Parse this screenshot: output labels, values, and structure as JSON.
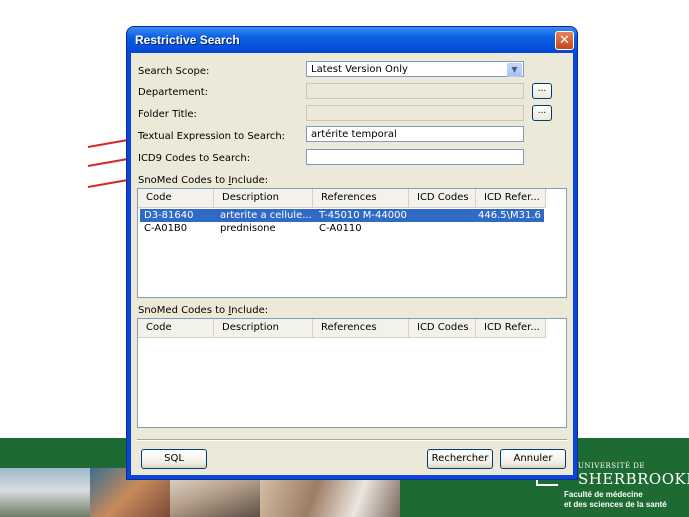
{
  "dialog": {
    "title": "Restrictive Search",
    "close_symbol": "✕"
  },
  "form": {
    "search_scope_label": "Search Scope:",
    "search_scope_value": "Latest Version Only",
    "departement_label": "Departement:",
    "folder_title_label": "Folder Title:",
    "browse_label": "...",
    "textual_label": "Textual Expression to Search:",
    "textual_value": "artérite temporal",
    "icd9_label": "ICD9 Codes to Search:",
    "icd9_value": ""
  },
  "snomed_include_1": {
    "label_prefix": "SnoMed Codes to ",
    "label_accel": "I",
    "label_suffix": "nclude:",
    "columns": [
      "Code",
      "Description",
      "References",
      "ICD Codes",
      "ICD Refer..."
    ],
    "rows": [
      [
        "D3-81640",
        "arterite a cellule...",
        "T-45010 M-44000",
        "",
        "446.5\\M31.6"
      ],
      [
        "C-A01B0",
        "prednisone",
        "C-A0110",
        "",
        ""
      ]
    ]
  },
  "snomed_include_2": {
    "label_prefix": "SnoMed Codes to ",
    "label_accel": "I",
    "label_suffix": "nclude:",
    "columns": [
      "Code",
      "Description",
      "References",
      "ICD Codes",
      "ICD Refer..."
    ]
  },
  "buttons": {
    "sql": "SQL",
    "rechercher": "Rechercher",
    "annuler": "Annuler"
  },
  "logo": {
    "top": "UNIVERSITÉ DE",
    "name": "SHERBROOKE",
    "sub_line1": "Faculté de médecine",
    "sub_line2": "et des sciences de la santé"
  },
  "colors": {
    "annotation_red": "#d8282a",
    "selection_blue": "#316ac5",
    "banner_green": "#1d6a33"
  }
}
